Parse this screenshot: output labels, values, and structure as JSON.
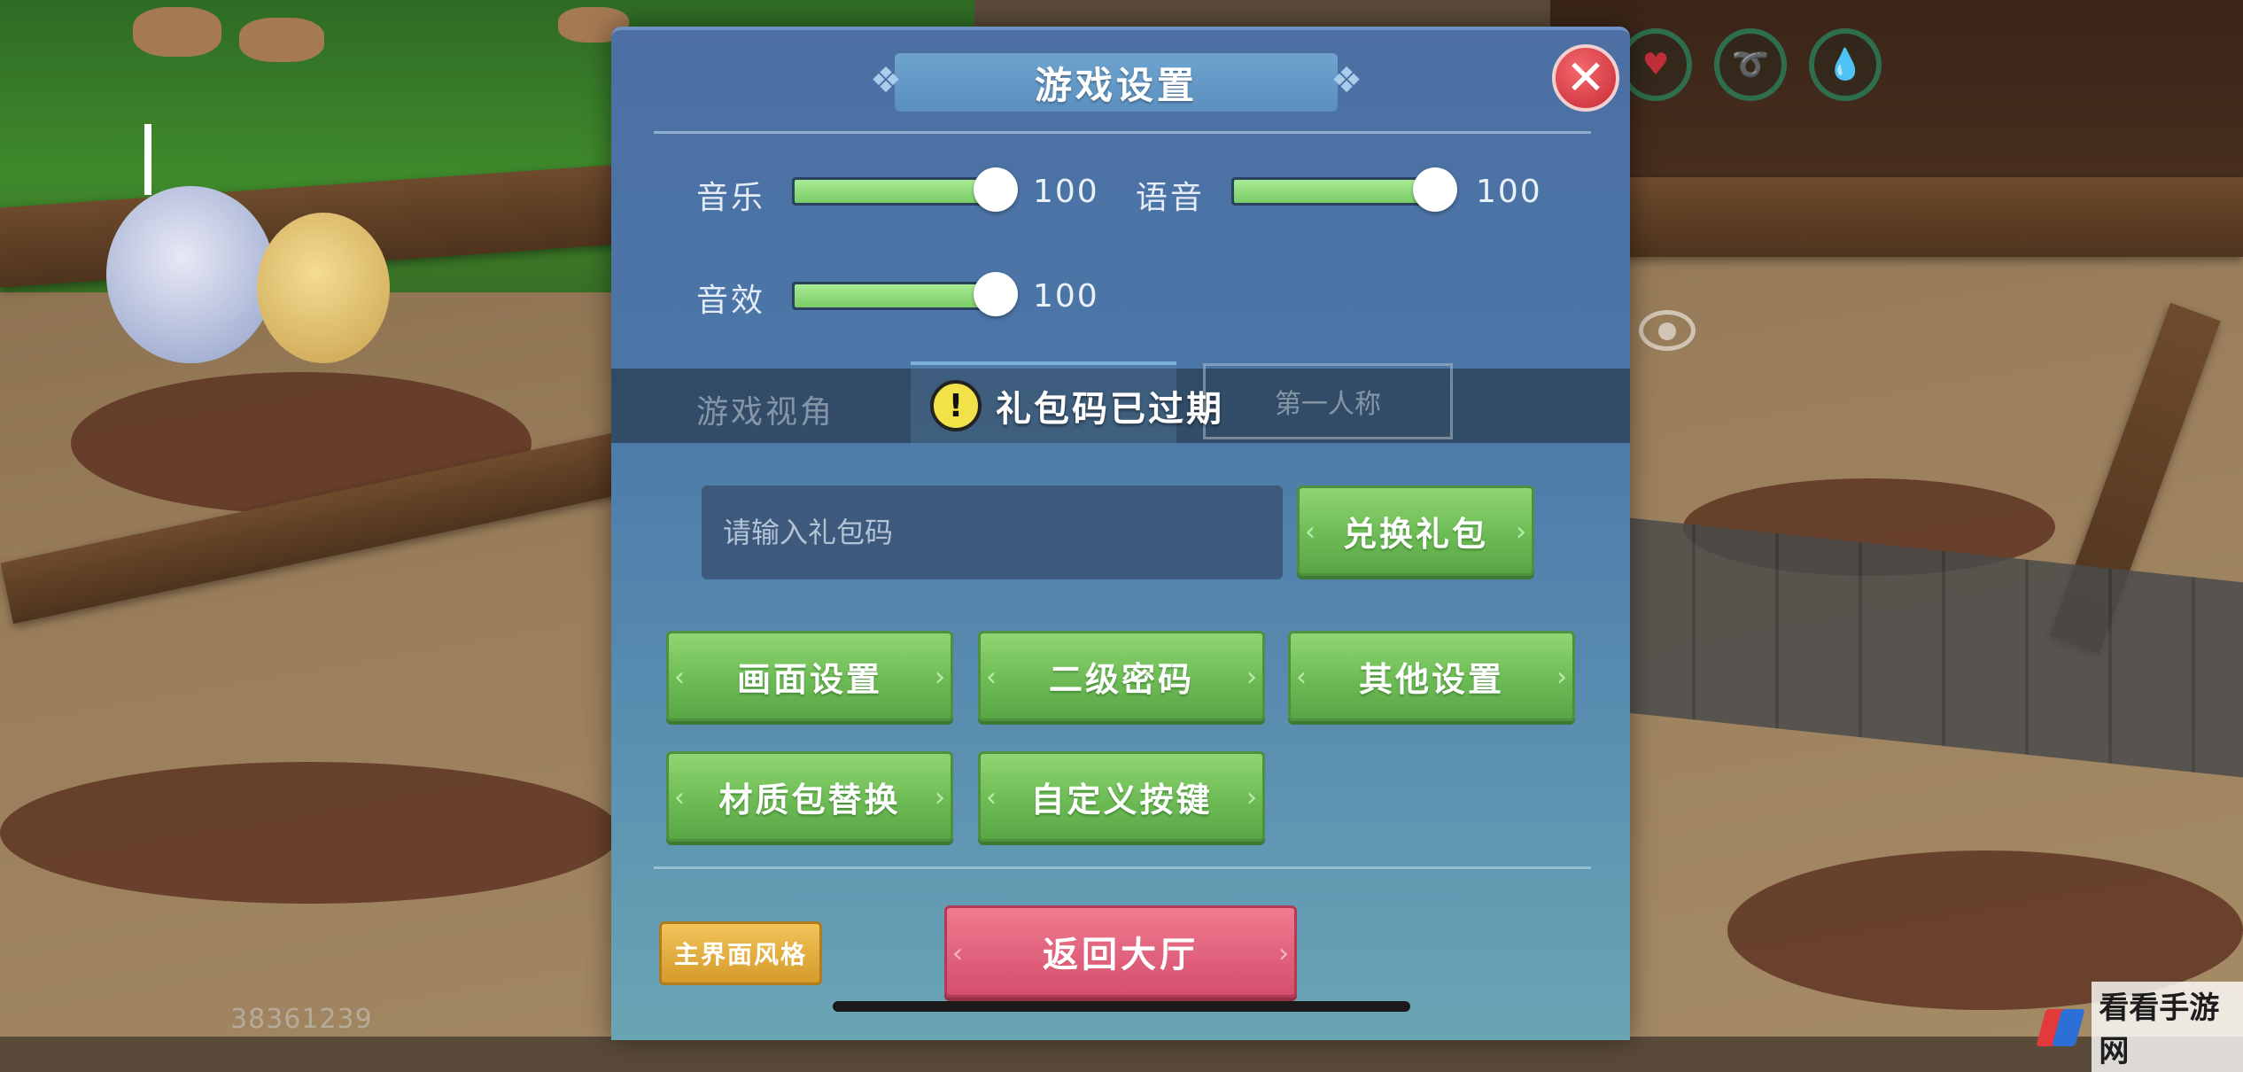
{
  "hud": {
    "player_id": "38361239",
    "status_icons": [
      "heart-icon",
      "stamina-icon",
      "water-drop-icon"
    ]
  },
  "settings": {
    "title": "游戏设置",
    "close_icon": "close-icon",
    "sliders": [
      {
        "label": "音乐",
        "value": "100",
        "level": 1.0
      },
      {
        "label": "语音",
        "value": "100",
        "level": 1.0
      },
      {
        "label": "音效",
        "value": "100",
        "level": 1.0
      }
    ],
    "view": {
      "label": "游戏视角",
      "option_first_person": "第一人称"
    },
    "toast": {
      "text": "礼包码已过期"
    },
    "gift_code": {
      "placeholder": "请输入礼包码",
      "redeem_label": "兑换礼包"
    },
    "buttons": {
      "graphics": "画面设置",
      "secondary_password": "二级密码",
      "other": "其他设置",
      "texture_pack": "材质包替换",
      "custom_keys": "自定义按键",
      "ui_style": "主界面风格",
      "return_lobby": "返回大厅"
    }
  },
  "watermark": {
    "text": "看看手游网"
  },
  "colors": {
    "panel": "#4b77a8",
    "green_button": "#6dbb55",
    "red_button": "#d44f6c",
    "yellow_button": "#d59a2a",
    "slider_fill": "#7ccd68"
  }
}
